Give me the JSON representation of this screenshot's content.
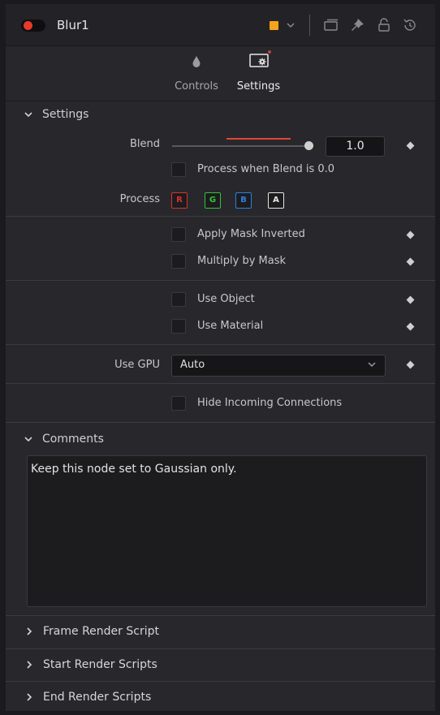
{
  "header": {
    "node_name": "Blur1",
    "enabled_color": "#e8392b",
    "node_color": "#f5a21c",
    "icons": [
      "version-icon",
      "pin-icon",
      "lock-icon",
      "reset-icon"
    ]
  },
  "tabs": [
    {
      "label": "Controls",
      "icon": "drop-icon",
      "active": false
    },
    {
      "label": "Settings",
      "icon": "settings-icon",
      "active": true
    }
  ],
  "settings": {
    "title": "Settings",
    "blend": {
      "label": "Blend",
      "value": "1.0",
      "slider_fraction": 1.0
    },
    "process_when_blend_zero": {
      "label": "Process when Blend is 0.0",
      "checked": false
    },
    "process": {
      "label": "Process",
      "channels": [
        {
          "label": "R",
          "color": "#d8332b"
        },
        {
          "label": "G",
          "color": "#33c33b"
        },
        {
          "label": "B",
          "color": "#2e7fe0"
        },
        {
          "label": "A",
          "color": "#e6e6e6"
        }
      ]
    },
    "apply_mask_inverted": {
      "label": "Apply Mask Inverted",
      "checked": false
    },
    "multiply_by_mask": {
      "label": "Multiply by Mask",
      "checked": false
    },
    "use_object": {
      "label": "Use Object",
      "checked": false
    },
    "use_material": {
      "label": "Use Material",
      "checked": false
    },
    "use_gpu": {
      "label": "Use GPU",
      "value": "Auto"
    },
    "hide_incoming_connections": {
      "label": "Hide Incoming Connections",
      "checked": false
    }
  },
  "comments": {
    "title": "Comments",
    "text": "Keep this node set to Gaussian only."
  },
  "scripts": [
    {
      "label": "Frame Render Script"
    },
    {
      "label": "Start Render Scripts"
    },
    {
      "label": "End Render Scripts"
    }
  ]
}
